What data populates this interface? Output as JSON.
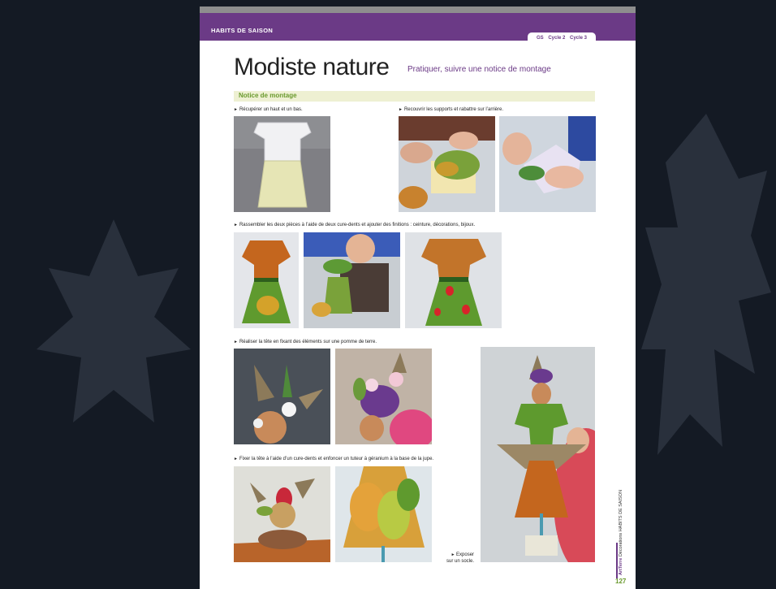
{
  "header": {
    "series": "HABITS DE SAISON",
    "cycles": [
      "GS",
      "Cycle 2",
      "Cycle 3"
    ]
  },
  "title": "Modiste nature",
  "subtitle": "Pratiquer, suivre une notice de montage",
  "section": "Notice de montage",
  "steps": {
    "s1": "Récupérer un haut et un bas.",
    "s2": "Recouvrir les supports et rabattre sur l’arrière.",
    "s3": "Rassembler les deux pièces à l’aide de deux cure-dents et ajouter des finitions : ceinture, décorations, bijoux.",
    "s4": "Réaliser la tête en fixant des éléments sur une pomme de terre.",
    "s5": "Fixer la tête à l’aide d’un cure-dents et enfoncer un tuteur à géranium à la base de la jupe."
  },
  "caption": {
    "line1": "Exposer",
    "line2": "sur un socle."
  },
  "sidebar": {
    "brand": "ArtTerre",
    "text": "Décorations HABITS DE SAISON"
  },
  "page_number": "127",
  "colors": {
    "purple": "#6b3a86",
    "green": "#6a9a2e",
    "background": "#141a24"
  }
}
